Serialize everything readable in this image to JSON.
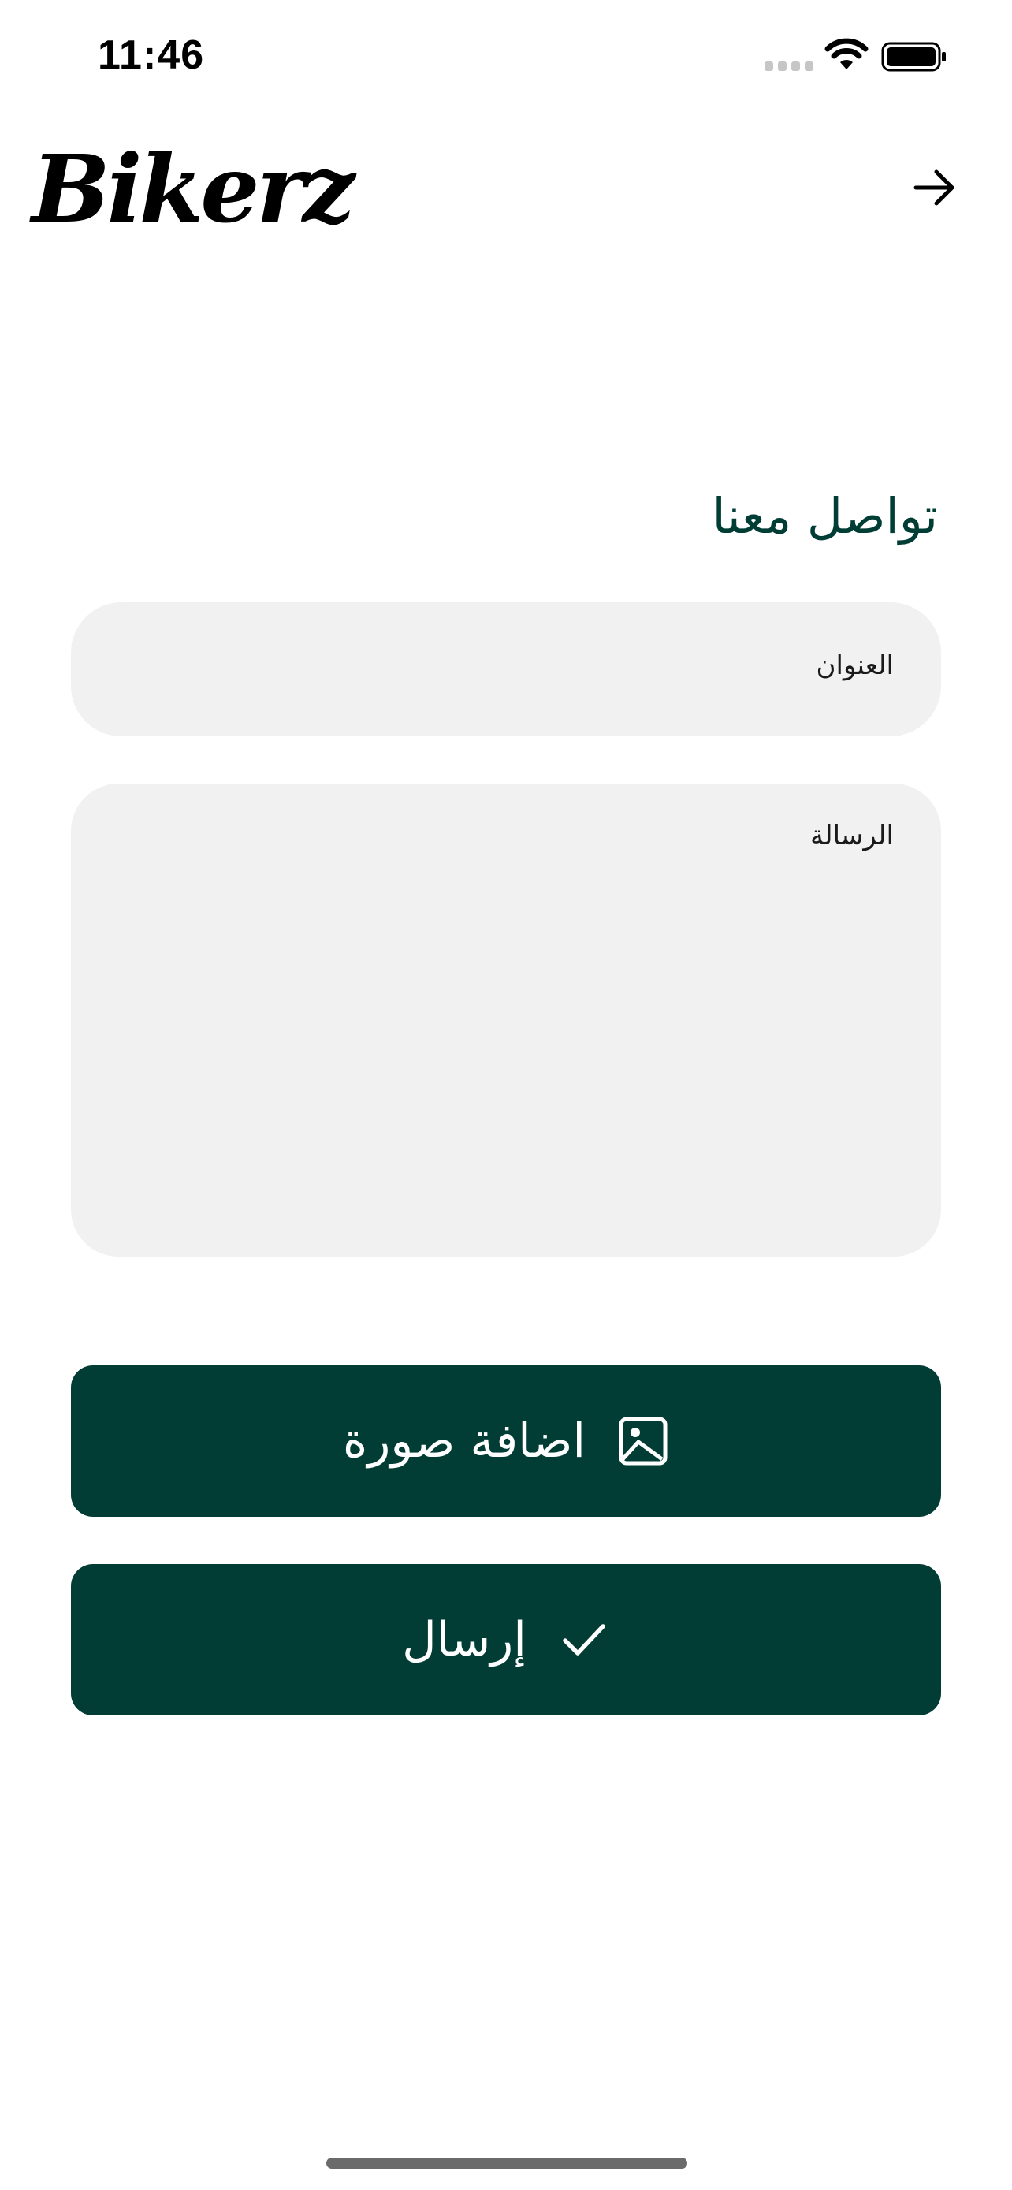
{
  "status_bar": {
    "time": "11:46"
  },
  "header": {
    "brand": "Bikerz",
    "back_icon": "arrow-right-icon"
  },
  "contact_form": {
    "title": "تواصل معنا",
    "subject_placeholder": "العنوان",
    "message_placeholder": "الرسالة",
    "add_image_label": "اضافة صورة",
    "add_image_icon": "image-icon",
    "send_label": "إرسال",
    "send_icon": "check-icon"
  },
  "colors": {
    "primary": "#023d35",
    "field_background": "#f1f1f1",
    "title_color": "#003d35"
  }
}
